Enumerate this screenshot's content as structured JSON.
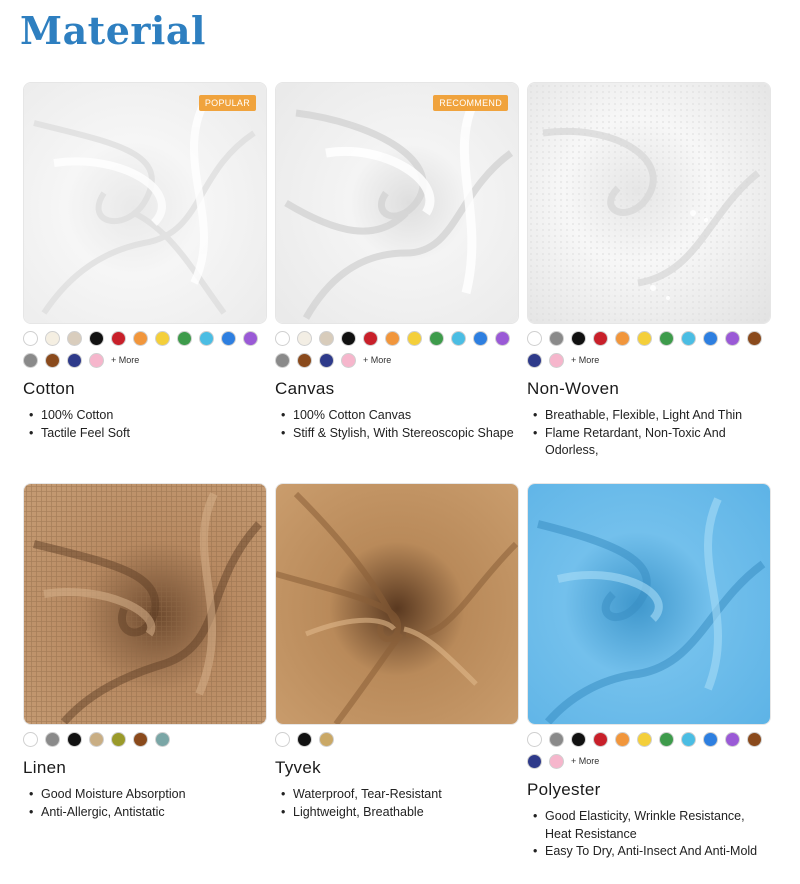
{
  "page_title": "Material",
  "more_label": "+ More",
  "materials": [
    {
      "name": "Cotton",
      "badge": "POPULAR",
      "features": [
        "100% Cotton",
        "Tactile Feel Soft"
      ],
      "colors": [
        "#ffffff",
        "#f5efe2",
        "#d9cdbd",
        "#111111",
        "#c8202a",
        "#f1963c",
        "#f4cf3a",
        "#3e9b4b",
        "#4bbde3",
        "#2e7fe0",
        "#9a5ad6",
        "#8a8a8a",
        "#8a4a1c",
        "#2e3a8a",
        "#f6b6cc"
      ],
      "has_more": true
    },
    {
      "name": "Canvas",
      "badge": "RECOMMEND",
      "features": [
        "100% Cotton Canvas",
        "Stiff & Stylish, With Stereoscopic Shape"
      ],
      "colors": [
        "#ffffff",
        "#f3eee4",
        "#d8ccbb",
        "#111111",
        "#c8202a",
        "#f1963c",
        "#f4cf3a",
        "#3e9b4b",
        "#4bbde3",
        "#2e7fe0",
        "#9a5ad6",
        "#8a8a8a",
        "#8a4a1c",
        "#2e3a8a",
        "#f6b6cc"
      ],
      "has_more": true
    },
    {
      "name": "Non-Woven",
      "badge": "",
      "features": [
        "Breathable, Flexible, Light And Thin",
        "Flame Retardant, Non-Toxic And Odorless,"
      ],
      "colors": [
        "#ffffff",
        "#8a8a8a",
        "#111111",
        "#c8202a",
        "#f1963c",
        "#f4cf3a",
        "#3e9b4b",
        "#4bbde3",
        "#2e7fe0",
        "#9a5ad6",
        "#8a4a1c",
        "#2e3a8a",
        "#f6b6cc"
      ],
      "has_more": true
    },
    {
      "name": "Linen",
      "badge": "",
      "features": [
        "Good Moisture Absorption",
        "Anti-Allergic, Antistatic"
      ],
      "colors": [
        "#ffffff",
        "#8a8a8a",
        "#111111",
        "#c9ae84",
        "#9a9a2a",
        "#8a4a1c",
        "#7aa6a6"
      ],
      "has_more": false
    },
    {
      "name": "Tyvek",
      "badge": "",
      "features": [
        "Waterproof, Tear-Resistant",
        "Lightweight, Breathable"
      ],
      "colors": [
        "#ffffff",
        "#111111",
        "#caa866"
      ],
      "has_more": false
    },
    {
      "name": "Polyester",
      "badge": "",
      "features": [
        "Good Elasticity, Wrinkle Resistance, Heat Resistance",
        "Easy To Dry, Anti-Insect And Anti-Mold"
      ],
      "colors": [
        "#ffffff",
        "#8a8a8a",
        "#111111",
        "#c8202a",
        "#f1963c",
        "#f4cf3a",
        "#3e9b4b",
        "#4bbde3",
        "#2e7fe0",
        "#9a5ad6",
        "#8a4a1c",
        "#2e3a8a",
        "#f6b6cc"
      ],
      "has_more": true
    }
  ]
}
